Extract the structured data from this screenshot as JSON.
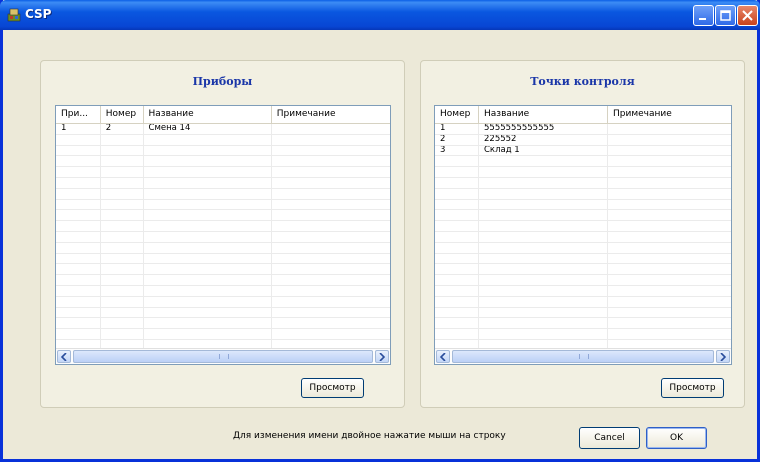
{
  "window": {
    "title": "CSP"
  },
  "devices": {
    "title": "Приборы",
    "columns": [
      "При...",
      "Номер",
      "Название",
      "Примечание"
    ],
    "rows": [
      [
        "1",
        "2",
        "Смена 14",
        ""
      ]
    ],
    "view_button": "Просмотр"
  },
  "checkpoints": {
    "title": "Точки контроля",
    "columns": [
      "Номер",
      "Название",
      "Примечание"
    ],
    "rows": [
      [
        "1",
        "5555555555555",
        ""
      ],
      [
        "2",
        "225552",
        ""
      ],
      [
        "3",
        "Склад 1",
        ""
      ]
    ],
    "view_button": "Просмотр"
  },
  "footer": {
    "hint": "Для изменения имени двойное нажатие мыши на строку",
    "cancel_label": "Cancel",
    "ok_label": "OK"
  },
  "colors": {
    "titlebar": "#0a57e0",
    "panel_title": "#1a36a8",
    "background": "#ece9d8"
  },
  "icons": {
    "app": "app-icon",
    "minimize": "minimize-icon",
    "maximize": "maximize-icon",
    "close": "close-icon"
  }
}
